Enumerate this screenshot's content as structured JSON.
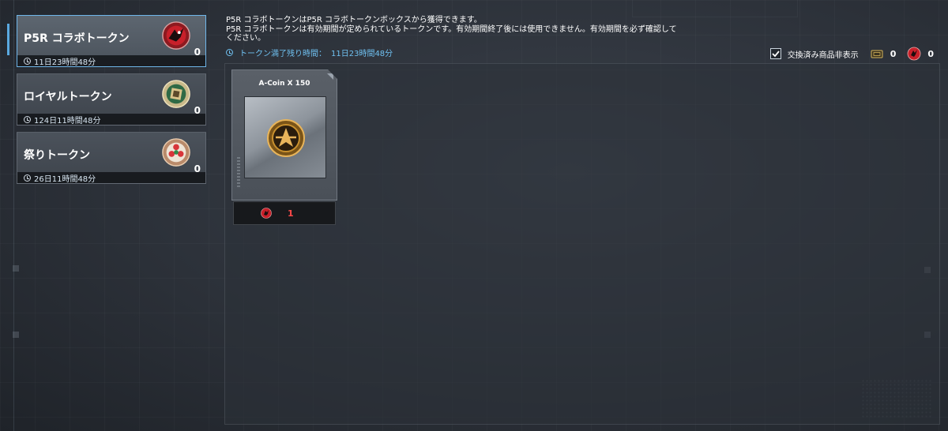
{
  "sidebar": {
    "tokens": [
      {
        "name": "P5R コラボトークン",
        "count": "0",
        "timer": "11日23時間48分",
        "active": true,
        "icon": "p5r-token-icon"
      },
      {
        "name": "ロイヤルトークン",
        "count": "0",
        "timer": "124日11時間48分",
        "active": false,
        "icon": "royal-token-icon"
      },
      {
        "name": "祭りトークン",
        "count": "0",
        "timer": "26日11時間48分",
        "active": false,
        "icon": "festival-token-icon"
      }
    ]
  },
  "description": {
    "line1": "P5R コラボトークンはP5R コラボトークンボックスから獲得できます。",
    "line2": "P5R コラボトークンは有効期間が定められているトークンです。有効期間終了後には使用できません。有効期間を必ず確認して",
    "line3": "ください。",
    "remaining_label": "トークン満了残り時間：",
    "remaining_value": "11日23時間48分"
  },
  "toolbar": {
    "hide_exchanged_label": "交換済み商品非表示",
    "hide_exchanged_checked": true,
    "currency1_icon": "ticket-icon",
    "currency1_value": "0",
    "currency2_icon": "p5r-token-icon",
    "currency2_value": "0"
  },
  "items": [
    {
      "title": "A-Coin X 150",
      "price": "1",
      "price_icon": "p5r-token-icon",
      "image_icon": "a-coin-icon"
    }
  ],
  "colors": {
    "accent_blue": "#6fc0f0",
    "price_red": "#ff4a4a",
    "p5r_red": "#c8202a",
    "coin_gold": "#c8902e"
  }
}
